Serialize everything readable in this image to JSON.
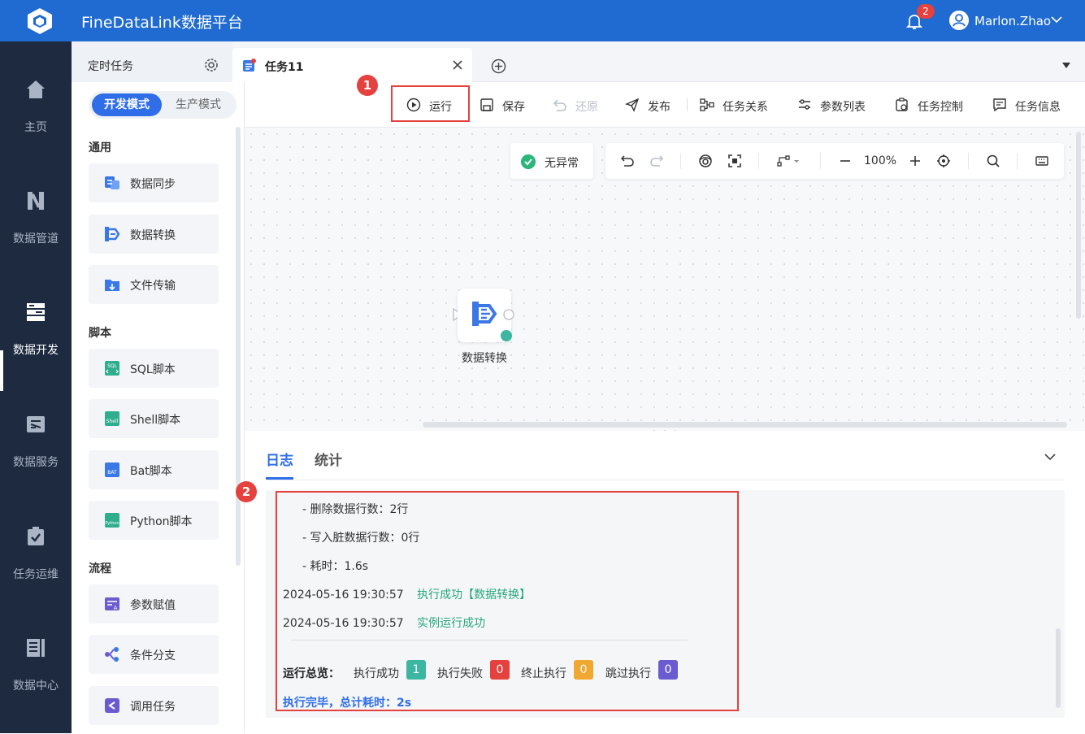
{
  "app": {
    "title": "FineDataLink数据平台"
  },
  "header": {
    "notification_count": "2",
    "user_name": "Marlon.Zhao"
  },
  "leftnav": {
    "items": [
      {
        "label": "主页",
        "icon": "home-icon"
      },
      {
        "label": "数据管道",
        "icon": "pipeline-icon"
      },
      {
        "label": "数据开发",
        "icon": "dev-icon",
        "active": true
      },
      {
        "label": "数据服务",
        "icon": "service-icon"
      },
      {
        "label": "任务运维",
        "icon": "ops-icon"
      },
      {
        "label": "数据中心",
        "icon": "datacenter-icon"
      }
    ]
  },
  "tabs": {
    "schedule_label": "定时任务",
    "task_label": "任务11"
  },
  "mode": {
    "dev": "开发模式",
    "prod": "生产模式"
  },
  "sidebar": {
    "sections": [
      {
        "title": "通用",
        "items": [
          "数据同步",
          "数据转换",
          "文件传输"
        ]
      },
      {
        "title": "脚本",
        "items": [
          "SQL脚本",
          "Shell脚本",
          "Bat脚本",
          "Python脚本"
        ]
      },
      {
        "title": "流程",
        "items": [
          "参数赋值",
          "条件分支",
          "调用任务"
        ]
      }
    ]
  },
  "toolbar": {
    "run": "运行",
    "save": "保存",
    "restore": "还原",
    "publish": "发布",
    "relation": "任务关系",
    "params": "参数列表",
    "control": "任务控制",
    "info": "任务信息"
  },
  "callouts": {
    "one": "1",
    "two": "2"
  },
  "canvas": {
    "status": "无异常",
    "zoom": "100%",
    "node_label": "数据转换"
  },
  "log": {
    "tab_log": "日志",
    "tab_stats": "统计",
    "lines": [
      "- 删除数据行数：2行",
      "- 写入脏数据行数：0行",
      "- 耗时：1.6s"
    ],
    "entries": [
      {
        "time": "2024-05-16 19:30:57",
        "msg": "执行成功【数据转换】"
      },
      {
        "time": "2024-05-16 19:30:57",
        "msg": "实例运行成功"
      }
    ],
    "summary_label": "运行总览：",
    "summary": [
      {
        "label": "执行成功",
        "count": "1",
        "color": "#3cb6a0"
      },
      {
        "label": "执行失败",
        "count": "0",
        "color": "#e5413e"
      },
      {
        "label": "终止执行",
        "count": "0",
        "color": "#f0a830"
      },
      {
        "label": "跳过执行",
        "count": "0",
        "color": "#6b5bd0"
      }
    ],
    "final": "执行完毕，总计耗时：2s"
  }
}
